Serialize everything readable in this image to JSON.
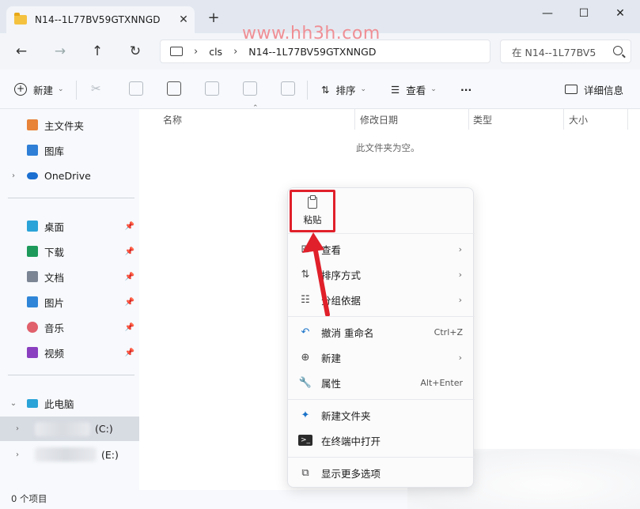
{
  "window": {
    "tab_title": "N14--1L77BV59GTXNNGD",
    "new_tab": "+",
    "close_tab": "✕",
    "minimize": "—",
    "maximize": "☐",
    "close": "✕"
  },
  "watermark": "www.hh3h.com",
  "address": {
    "crumbs": [
      "cls",
      "N14--1L77BV59GTXNNGD"
    ],
    "separator": "›",
    "search_placeholder": "在 N14--1L77BV5"
  },
  "toolbar": {
    "new_label": "新建",
    "sort_label": "排序",
    "view_label": "查看",
    "more_label": "···",
    "details_label": "详细信息"
  },
  "sidebar": {
    "quick": [
      {
        "label": "主文件夹",
        "icon": "home-icon",
        "color": "#e8833a"
      },
      {
        "label": "图库",
        "icon": "gallery-icon",
        "color": "#2f7fd6"
      },
      {
        "label": "OneDrive",
        "icon": "onedrive-icon",
        "color": "#1b6fd1"
      }
    ],
    "pinned": [
      {
        "label": "桌面",
        "icon": "desktop-icon",
        "color": "#2aa3d8"
      },
      {
        "label": "下载",
        "icon": "download-icon",
        "color": "#1d9a5b"
      },
      {
        "label": "文档",
        "icon": "documents-icon",
        "color": "#7b8594"
      },
      {
        "label": "图片",
        "icon": "pictures-icon",
        "color": "#2f86d8"
      },
      {
        "label": "音乐",
        "icon": "music-icon",
        "color": "#e0606c"
      },
      {
        "label": "视频",
        "icon": "videos-icon",
        "color": "#8a3fc0"
      }
    ],
    "this_pc": "此电脑",
    "drives": [
      "(C:)",
      "(E:)"
    ]
  },
  "columns": {
    "name": "名称",
    "modified": "修改日期",
    "type": "类型",
    "size": "大小"
  },
  "empty_message": "此文件夹为空。",
  "status": "0 个项目",
  "context_menu": {
    "paste": "粘贴",
    "items": [
      {
        "label": "查看",
        "icon": "view-grid-icon"
      },
      {
        "label": "排序方式",
        "icon": "sort-icon"
      },
      {
        "label": "分组依据",
        "icon": "group-icon"
      },
      {
        "label": "撤消 重命名",
        "shortcut": "Ctrl+Z",
        "icon": "undo-icon"
      },
      {
        "label": "新建",
        "icon": "new-icon"
      },
      {
        "label": "属性",
        "shortcut": "Alt+Enter",
        "icon": "properties-icon"
      },
      {
        "label": "新建文件夹",
        "icon": "new-folder-icon"
      },
      {
        "label": "在终端中打开",
        "icon": "terminal-icon"
      },
      {
        "label": "显示更多选项",
        "icon": "more-options-icon"
      }
    ]
  },
  "colors": {
    "highlight_box": "#e0202a",
    "arrow": "#e0202a"
  }
}
